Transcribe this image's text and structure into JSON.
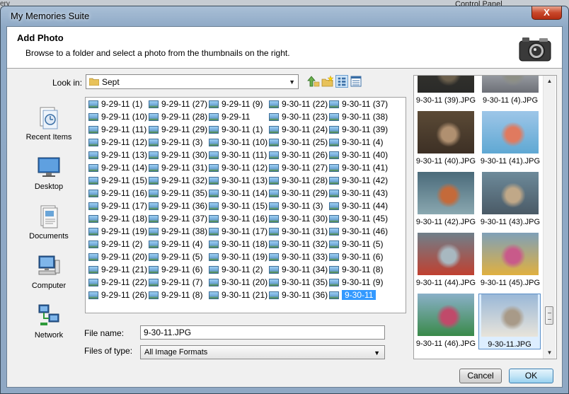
{
  "background": {
    "topright_text": "Control Panel",
    "topleft_text": "ery"
  },
  "window": {
    "title": "My Memories Suite",
    "close_label": "X"
  },
  "header": {
    "title": "Add Photo",
    "subtitle": "Browse to a folder and select a photo from the thumbnails on the right."
  },
  "lookin": {
    "label": "Look in:",
    "value": "Sept"
  },
  "places": [
    "Recent Items",
    "Desktop",
    "Documents",
    "Computer",
    "Network"
  ],
  "files": {
    "columns": [
      [
        "9-29-11 (1)",
        "9-29-11 (10)",
        "9-29-11 (11)",
        "9-29-11 (12)",
        "9-29-11 (13)",
        "9-29-11 (14)",
        "9-29-11 (15)",
        "9-29-11 (16)",
        "9-29-11 (17)",
        "9-29-11 (18)",
        "9-29-11 (19)",
        "9-29-11 (2)",
        "9-29-11 (20)",
        "9-29-11 (21)",
        "9-29-11 (22)",
        "9-29-11 (26)"
      ],
      [
        "9-29-11 (27)",
        "9-29-11 (28)",
        "9-29-11 (29)",
        "9-29-11 (3)",
        "9-29-11 (30)",
        "9-29-11 (31)",
        "9-29-11 (32)",
        "9-29-11 (35)",
        "9-29-11 (36)",
        "9-29-11 (37)",
        "9-29-11 (38)",
        "9-29-11 (4)",
        "9-29-11 (5)",
        "9-29-11 (6)",
        "9-29-11 (7)",
        "9-29-11 (8)"
      ],
      [
        "9-29-11 (9)",
        "9-29-11",
        "9-30-11 (1)",
        "9-30-11 (10)",
        "9-30-11 (11)",
        "9-30-11 (12)",
        "9-30-11 (13)",
        "9-30-11 (14)",
        "9-30-11 (15)",
        "9-30-11 (16)",
        "9-30-11 (17)",
        "9-30-11 (18)",
        "9-30-11 (19)",
        "9-30-11 (2)",
        "9-30-11 (20)",
        "9-30-11 (21)"
      ],
      [
        "9-30-11 (22)",
        "9-30-11 (23)",
        "9-30-11 (24)",
        "9-30-11 (25)",
        "9-30-11 (26)",
        "9-30-11 (27)",
        "9-30-11 (28)",
        "9-30-11 (29)",
        "9-30-11 (3)",
        "9-30-11 (30)",
        "9-30-11 (31)",
        "9-30-11 (32)",
        "9-30-11 (33)",
        "9-30-11 (34)",
        "9-30-11 (35)",
        "9-30-11 (36)"
      ],
      [
        "9-30-11 (37)",
        "9-30-11 (38)",
        "9-30-11 (39)",
        "9-30-11 (4)",
        "9-30-11 (40)",
        "9-30-11 (41)",
        "9-30-11 (42)",
        "9-30-11 (43)",
        "9-30-11 (44)",
        "9-30-11 (45)",
        "9-30-11 (46)",
        "9-30-11 (5)",
        "9-30-11 (6)",
        "9-30-11 (8)",
        "9-30-11 (9)",
        "9-30-11"
      ]
    ],
    "selected": "9-30-11"
  },
  "filename": {
    "label": "File name:",
    "value": "9-30-11.JPG"
  },
  "filetype": {
    "label": "Files of type:",
    "value": "All Image Formats"
  },
  "thumbnails": [
    "9-30-11 (39).JPG",
    "9-30-11 (4).JPG",
    "9-30-11 (40).JPG",
    "9-30-11 (41).JPG",
    "9-30-11 (42).JPG",
    "9-30-11 (43).JPG",
    "9-30-11 (44).JPG",
    "9-30-11 (45).JPG",
    "9-30-11 (46).JPG",
    "9-30-11.JPG"
  ],
  "buttons": {
    "cancel": "Cancel",
    "ok": "OK"
  }
}
